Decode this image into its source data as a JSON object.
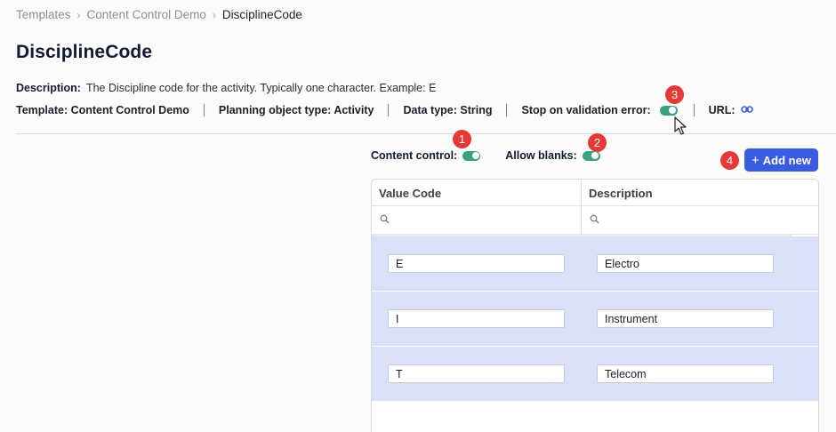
{
  "breadcrumb": [
    {
      "label": "Templates"
    },
    {
      "label": "Content Control Demo"
    },
    {
      "label": "DisciplineCode"
    }
  ],
  "page": {
    "title": "DisciplineCode"
  },
  "description": {
    "label": "Description:",
    "text": "The Discipline code for the activity. Typically one character. Example: E"
  },
  "meta": {
    "template": "Template: Content Control Demo",
    "planning_object_type": "Planning object type: Activity",
    "data_type": "Data type: String",
    "stop_on_validation_error": "Stop on validation error:",
    "url": "URL:"
  },
  "toggles": {
    "stop_on_validation_error": true,
    "content_control": true,
    "allow_blanks": true
  },
  "controls": {
    "content_control_label": "Content control:",
    "allow_blanks_label": "Allow blanks:"
  },
  "add_button": {
    "label": "Add new",
    "icon": "+"
  },
  "badges": [
    "1",
    "2",
    "3",
    "4"
  ],
  "grid": {
    "columns": [
      "Value Code",
      "Description"
    ],
    "rows": [
      {
        "code": "E",
        "description": "Electro"
      },
      {
        "code": "I",
        "description": "Instrument"
      },
      {
        "code": "T",
        "description": "Telecom"
      }
    ]
  },
  "colors": {
    "accent": "#3b5be0",
    "toggle_on": "#3aa17e",
    "badge": "#e53935",
    "row_highlight": "#d9e0f7"
  }
}
